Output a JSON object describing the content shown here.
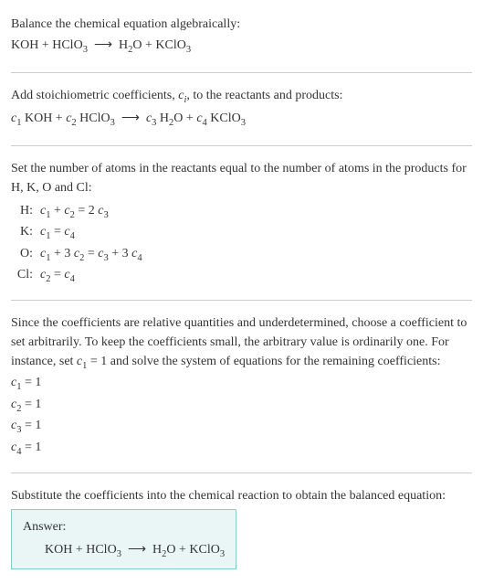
{
  "problem": {
    "prompt": "Balance the chemical equation algebraically:",
    "equation_html": "KOH + HClO<sub>3</sub> &nbsp;⟶&nbsp; H<sub>2</sub>O + KClO<sub>3</sub>"
  },
  "stoich": {
    "prompt_html": "Add stoichiometric coefficients, <span class='ital'>c<sub>i</sub></span>, to the reactants and products:",
    "equation_html": "<span class='ital'>c</span><sub>1</sub> KOH + <span class='ital'>c</span><sub>2</sub> HClO<sub>3</sub> &nbsp;⟶&nbsp; <span class='ital'>c</span><sub>3</sub> H<sub>2</sub>O + <span class='ital'>c</span><sub>4</sub> KClO<sub>3</sub>"
  },
  "atoms": {
    "prompt": "Set the number of atoms in the reactants equal to the number of atoms in the products for H, K, O and Cl:",
    "rows": [
      {
        "label": "H:",
        "eq_html": "<span class='ital'>c</span><sub>1</sub> + <span class='ital'>c</span><sub>2</sub> = 2 <span class='ital'>c</span><sub>3</sub>"
      },
      {
        "label": "K:",
        "eq_html": "<span class='ital'>c</span><sub>1</sub> = <span class='ital'>c</span><sub>4</sub>"
      },
      {
        "label": "O:",
        "eq_html": "<span class='ital'>c</span><sub>1</sub> + 3 <span class='ital'>c</span><sub>2</sub> = <span class='ital'>c</span><sub>3</sub> + 3 <span class='ital'>c</span><sub>4</sub>"
      },
      {
        "label": "Cl:",
        "eq_html": "<span class='ital'>c</span><sub>2</sub> = <span class='ital'>c</span><sub>4</sub>"
      }
    ]
  },
  "solve": {
    "prompt_html": "Since the coefficients are relative quantities and underdetermined, choose a coefficient to set arbitrarily. To keep the coefficients small, the arbitrary value is ordinarily one. For instance, set <span class='ital'>c</span><sub>1</sub> = 1 and solve the system of equations for the remaining coefficients:",
    "results": [
      {
        "html": "<span class='ital'>c</span><sub>1</sub> = 1"
      },
      {
        "html": "<span class='ital'>c</span><sub>2</sub> = 1"
      },
      {
        "html": "<span class='ital'>c</span><sub>3</sub> = 1"
      },
      {
        "html": "<span class='ital'>c</span><sub>4</sub> = 1"
      }
    ]
  },
  "substitute": {
    "prompt": "Substitute the coefficients into the chemical reaction to obtain the balanced equation:"
  },
  "answer": {
    "label": "Answer:",
    "equation_html": "KOH + HClO<sub>3</sub> &nbsp;⟶&nbsp; H<sub>2</sub>O + KClO<sub>3</sub>"
  }
}
